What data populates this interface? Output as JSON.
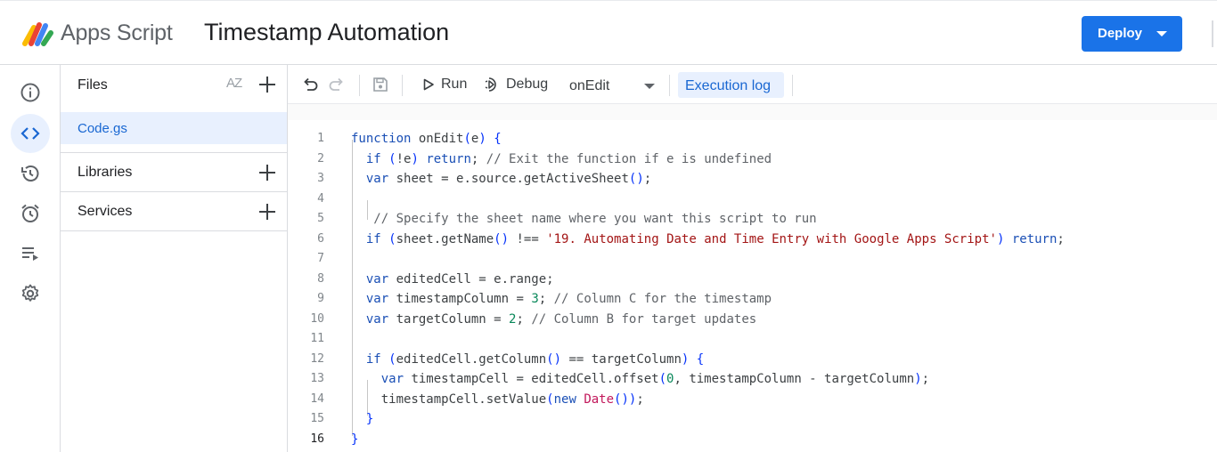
{
  "header": {
    "app_name": "Apps Script",
    "project_title": "Timestamp Automation",
    "deploy_label": "Deploy"
  },
  "rail": {
    "items": [
      "overview-icon",
      "editor-icon",
      "triggers-history-icon",
      "triggers-icon",
      "executions-icon",
      "settings-icon"
    ],
    "active": "editor-icon"
  },
  "files_panel": {
    "title": "Files",
    "sort_label": "AZ",
    "files": [
      "Code.gs"
    ],
    "libraries_label": "Libraries",
    "services_label": "Services"
  },
  "toolbar": {
    "run_label": "Run",
    "debug_label": "Debug",
    "function_selected": "onEdit",
    "execution_log_label": "Execution log"
  },
  "code": {
    "current_line": 16,
    "line_numbers": [
      "1",
      "2",
      "3",
      "4",
      "5",
      "6",
      "7",
      "8",
      "9",
      "10",
      "11",
      "12",
      "13",
      "14",
      "15",
      "16"
    ],
    "lines": [
      "function onEdit(e) {",
      "  if (!e) return; // Exit the function if e is undefined",
      "  var sheet = e.source.getActiveSheet();",
      "",
      "   // Specify the sheet name where you want this script to run",
      "  if (sheet.getName() !== '19. Automating Date and Time Entry with Google Apps Script') return;",
      "",
      "  var editedCell = e.range;",
      "  var timestampColumn = 3; // Column C for the timestamp",
      "  var targetColumn = 2; // Column B for target updates",
      "",
      "  if (editedCell.getColumn() == targetColumn) {",
      "    var timestampCell = editedCell.offset(0, timestampColumn - targetColumn);",
      "    timestampCell.setValue(new Date());",
      "  }",
      "}"
    ]
  },
  "colors": {
    "accent": "#1a73e8",
    "active_bg": "#e8f0fe",
    "keyword": "#1a4fb5",
    "string": "#a31515",
    "comment": "#5f6368",
    "number": "#09885a"
  }
}
